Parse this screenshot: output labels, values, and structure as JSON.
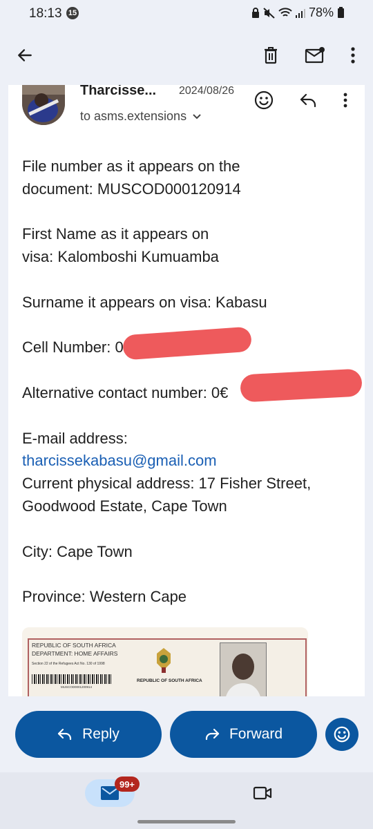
{
  "status_bar": {
    "time": "18:13",
    "notification_count": "15",
    "battery": "78%"
  },
  "toolbar": {
    "back_icon": "arrow-back-icon",
    "delete_icon": "trash-icon",
    "mark_unread_icon": "mail-unread-icon",
    "more_icon": "more-vert-icon"
  },
  "email": {
    "sender": "Tharcisse...",
    "date": "2024/08/26",
    "recipient": "to asms.extensions",
    "body": {
      "file_number_line1": "File number as it appears on the",
      "file_number_line2": "document:  MUSCOD000120914",
      "first_name_line1": "First Name as it appears on",
      "first_name_line2": "visa: Kalomboshi Kumuamba",
      "surname": "Surname it appears on visa: Kabasu",
      "cell_label": "Cell Number: ",
      "cell_visible": "0",
      "alt_label": "Alternative contact number:  ",
      "alt_visible": "0€",
      "email_label": "E-mail address:",
      "email_value": "tharcissekabasu@gmail.com",
      "address_line1": "Current physical address: 17 Fisher Street,",
      "address_line2": "Goodwood Estate, Cape Town",
      "city": "City:  Cape Town",
      "province": "Province: Western Cape"
    },
    "attachment": {
      "line1": "REPUBLIC OF SOUTH AFRICA",
      "line2": "DEPARTMENT: HOME AFFAIRS",
      "line3": "Section 22 of the Refugees Act No. 130 of 1998",
      "barcode_text": "MUSCOD0001200914",
      "emblem_caption": "REPUBLIC OF SOUTH AFRICA"
    }
  },
  "actions": {
    "reply_label": "Reply",
    "forward_label": "Forward"
  },
  "bottom_nav": {
    "mail_badge": "99+"
  },
  "colors": {
    "primary": "#0b57a0",
    "background": "#edf0f7",
    "link": "#1a5fb4",
    "redaction": "#ee5a5c",
    "badge": "#b3261e"
  }
}
